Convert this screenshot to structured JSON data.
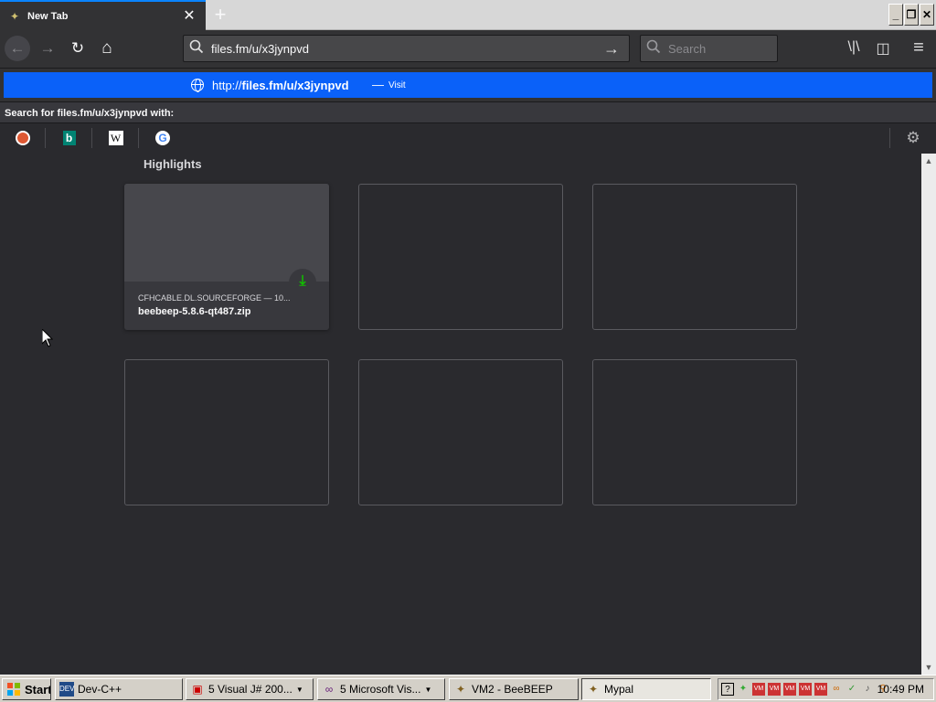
{
  "tab": {
    "title": "New Tab",
    "close": "✕",
    "new": "+"
  },
  "window": {
    "minimize": "_",
    "restore": "❐",
    "close": "✕"
  },
  "nav": {
    "back": "←",
    "forward": "→",
    "reload": "↻",
    "home": "⌂"
  },
  "urlbar": {
    "value": "files.fm/u/x3jynpvd",
    "go": "→",
    "search_icon": "search-icon"
  },
  "searchbar": {
    "placeholder": "Search"
  },
  "toolbar": {
    "library": "\\|\\",
    "sidebar": "◫",
    "menu": "≡"
  },
  "autocomplete": {
    "url_prefix": "http://",
    "url_bold": "files.fm/u/x3jynpvd",
    "separator": "—",
    "action": "Visit",
    "search_with": "Search for files.fm/u/x3jynpvd with:",
    "engines": [
      "DuckDuckGo",
      "Bing",
      "Wikipedia",
      "Google"
    ],
    "settings": "⚙"
  },
  "highlights": {
    "title": "Highlights",
    "cards": [
      {
        "source": "CFHCABLE.DL.SOURCEFORGE — 10...",
        "name": "beebeep-5.8.6-qt487.zip",
        "badge": "⤓"
      }
    ]
  },
  "taskbar": {
    "start": "Start",
    "tasks": [
      {
        "label": "Dev-C++"
      },
      {
        "label": "5 Visual J# 200..."
      },
      {
        "label": "5 Microsoft Vis..."
      },
      {
        "label": "VM2 - BeeBEEP"
      },
      {
        "label": "Mypal"
      }
    ],
    "clock": "10:49 PM"
  },
  "colors": {
    "accent": "#0a84ff",
    "popup_row": "#0a61f9",
    "background": "#2a2a2e",
    "download_green": "#12bc00"
  }
}
